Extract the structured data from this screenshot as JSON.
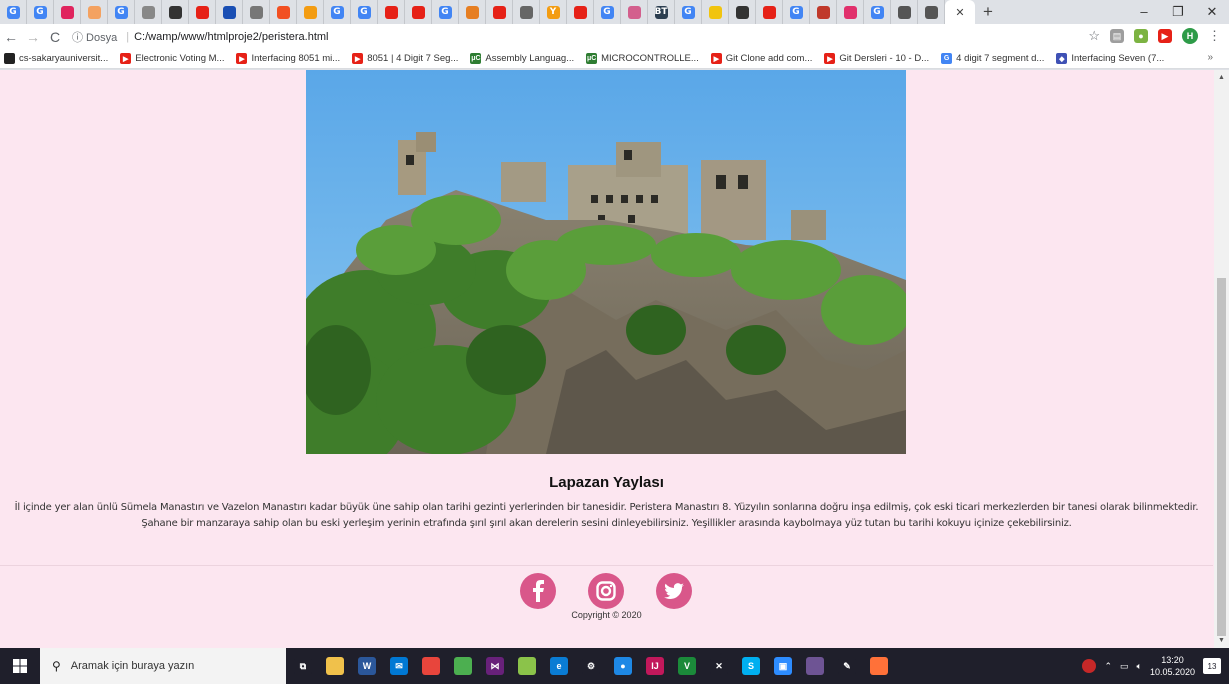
{
  "browser": {
    "tabs": [
      {
        "icon": "google-icon",
        "letter": "G",
        "color": "#4285f4"
      },
      {
        "icon": "google-icon",
        "letter": "G",
        "color": "#4285f4"
      },
      {
        "icon": "lips-icon",
        "letter": "",
        "color": "#e0245e"
      },
      {
        "icon": "figure-icon",
        "letter": "",
        "color": "#f4a261"
      },
      {
        "icon": "google-icon",
        "letter": "G",
        "color": "#4285f4"
      },
      {
        "icon": "mail-icon",
        "letter": "",
        "color": "#888888"
      },
      {
        "icon": "github-icon",
        "letter": "",
        "color": "#333333"
      },
      {
        "icon": "youtube-icon",
        "letter": "",
        "color": "#e62117"
      },
      {
        "icon": "circle-icon",
        "letter": "",
        "color": "#1a4fb4"
      },
      {
        "icon": "gear-icon",
        "letter": "",
        "color": "#777777"
      },
      {
        "icon": "grid-icon",
        "letter": "",
        "color": "#f25022"
      },
      {
        "icon": "diamond-icon",
        "letter": "",
        "color": "#f39c12"
      },
      {
        "icon": "google-icon",
        "letter": "G",
        "color": "#4285f4"
      },
      {
        "icon": "google-icon",
        "letter": "G",
        "color": "#4285f4"
      },
      {
        "icon": "youtube-icon",
        "letter": "",
        "color": "#e62117"
      },
      {
        "icon": "youtube-icon",
        "letter": "",
        "color": "#e62117"
      },
      {
        "icon": "google-icon",
        "letter": "G",
        "color": "#4285f4"
      },
      {
        "icon": "paint-icon",
        "letter": "",
        "color": "#e67e22"
      },
      {
        "icon": "youtube-icon",
        "letter": "",
        "color": "#e62117"
      },
      {
        "icon": "clock-icon",
        "letter": "",
        "color": "#666666"
      },
      {
        "icon": "yahoo-icon",
        "letter": "Y",
        "color": "#f39c12"
      },
      {
        "icon": "youtube-icon",
        "letter": "",
        "color": "#e62117"
      },
      {
        "icon": "google-icon",
        "letter": "G",
        "color": "#4285f4"
      },
      {
        "icon": "card-icon",
        "letter": "",
        "color": "#d35f8d"
      },
      {
        "icon": "bt-icon",
        "letter": "BT",
        "color": "#2c3e50"
      },
      {
        "icon": "google-icon",
        "letter": "G",
        "color": "#4285f4"
      },
      {
        "icon": "sun-icon",
        "letter": "",
        "color": "#f1c40f"
      },
      {
        "icon": "github-icon",
        "letter": "",
        "color": "#333333"
      },
      {
        "icon": "youtube-icon",
        "letter": "",
        "color": "#e62117"
      },
      {
        "icon": "google-icon",
        "letter": "G",
        "color": "#4285f4"
      },
      {
        "icon": "slash-icon",
        "letter": "",
        "color": "#c0392b"
      },
      {
        "icon": "instagram-icon",
        "letter": "",
        "color": "#e1306c"
      },
      {
        "icon": "google-icon",
        "letter": "G",
        "color": "#4285f4"
      },
      {
        "icon": "page-icon",
        "letter": "",
        "color": "#555555"
      },
      {
        "icon": "page-icon",
        "letter": "",
        "color": "#555555"
      }
    ],
    "active_tab_close": "✕",
    "new_tab": "+",
    "window_controls": {
      "minimize": "–",
      "maximize": "❐",
      "close": "✕"
    },
    "address": {
      "security_label": "ⓘ Dosya",
      "url": "C:/wamp/www/htmlproje2/peristera.html"
    },
    "profile_initial": "H",
    "bookmarks": [
      {
        "label": "cs-sakaryauniversit...",
        "icon": "github-icon",
        "color": "#222222",
        "letter": ""
      },
      {
        "label": "Electronic Voting M...",
        "icon": "youtube-icon",
        "color": "#e62117",
        "letter": "▶"
      },
      {
        "label": "Interfacing 8051 mi...",
        "icon": "youtube-icon",
        "color": "#e62117",
        "letter": "▶"
      },
      {
        "label": "8051 | 4 Digit 7 Seg...",
        "icon": "youtube-icon",
        "color": "#e62117",
        "letter": "▶"
      },
      {
        "label": "Assembly Languag...",
        "icon": "uc-icon",
        "color": "#2e7d32",
        "letter": "μC"
      },
      {
        "label": "MICROCONTROLLE...",
        "icon": "uc-icon",
        "color": "#2e7d32",
        "letter": "μC"
      },
      {
        "label": "Git Clone add com...",
        "icon": "youtube-icon",
        "color": "#e62117",
        "letter": "▶"
      },
      {
        "label": "Git Dersleri - 10 - D...",
        "icon": "youtube-icon",
        "color": "#e62117",
        "letter": "▶"
      },
      {
        "label": "4 digit 7 segment d...",
        "icon": "google-icon",
        "color": "#4285f4",
        "letter": "G"
      },
      {
        "label": "Interfacing Seven (7...",
        "icon": "diamond-icon",
        "color": "#3f51b5",
        "letter": "◆"
      }
    ],
    "bookmarks_more": "»"
  },
  "page": {
    "title": "Lapazan Yaylası",
    "description_line1": "İl içinde yer alan ünlü Sümela Manastırı ve Vazelon Manastırı kadar büyük üne sahip olan tarihi gezinti yerlerinden bir tanesidir. Peristera Manastırı 8. Yüzyılın sonlarına doğru inşa edilmiş, çok eski ticari merkezlerden bir tanesi olarak bilinmektedir.",
    "description_line2": "Şahane bir manzaraya sahip olan bu eski yerleşim yerinin etrafında şırıl şırıl akan derelerin sesini dinleyebilirsiniz. Yeşillikler arasında kaybolmaya yüz tutan bu tarihi kokuyu içinize çekebilirsiniz.",
    "copyright": "Copyright © 2020",
    "social_color": "#d9578a",
    "background_color": "#fce6f0"
  },
  "taskbar": {
    "search_placeholder": "Aramak için buraya yazın",
    "apps": [
      {
        "icon": "task-view-icon",
        "color": "#1f1f2b",
        "letter": "⧉"
      },
      {
        "icon": "file-explorer-icon",
        "color": "#f0c14b",
        "letter": ""
      },
      {
        "icon": "word-icon",
        "color": "#2b579a",
        "letter": "W"
      },
      {
        "icon": "mail-icon",
        "color": "#0078d4",
        "letter": "✉"
      },
      {
        "icon": "chrome-icon",
        "color": "#e8453c",
        "letter": ""
      },
      {
        "icon": "notepad-icon",
        "color": "#4caf50",
        "letter": ""
      },
      {
        "icon": "visual-studio-icon",
        "color": "#68217a",
        "letter": "⋈"
      },
      {
        "icon": "app-icon",
        "color": "#8bc34a",
        "letter": ""
      },
      {
        "icon": "edge-icon",
        "color": "#0a7cd4",
        "letter": "e"
      },
      {
        "icon": "settings-icon",
        "color": "#1f1f2b",
        "letter": "⚙"
      },
      {
        "icon": "record-icon",
        "color": "#1e88e5",
        "letter": "●"
      },
      {
        "icon": "intellij-icon",
        "color": "#c2185b",
        "letter": "IJ"
      },
      {
        "icon": "vim-icon",
        "color": "#1b8a3a",
        "letter": "V"
      },
      {
        "icon": "tools-icon",
        "color": "#1f1f2b",
        "letter": "✕"
      },
      {
        "icon": "skype-icon",
        "color": "#00aff0",
        "letter": "S"
      },
      {
        "icon": "zoom-icon",
        "color": "#2d8cff",
        "letter": "▣"
      },
      {
        "icon": "github-desktop-icon",
        "color": "#6e5494",
        "letter": ""
      },
      {
        "icon": "sublime-icon",
        "color": "#1f1f2b",
        "letter": "✎"
      },
      {
        "icon": "firefox-icon",
        "color": "#ff7139",
        "letter": ""
      }
    ],
    "time": "13:20",
    "date": "10.05.2020",
    "notification_count": "13"
  }
}
